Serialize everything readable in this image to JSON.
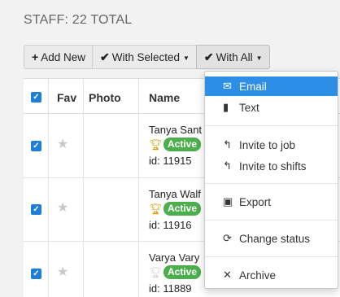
{
  "header": {
    "title": "STAFF: 22 TOTAL"
  },
  "toolbar": {
    "add_new": "Add New",
    "with_selected": "With Selected",
    "with_all": "With All"
  },
  "table": {
    "headers": {
      "fav": "Fav",
      "photo": "Photo",
      "name": "Name"
    },
    "rows": [
      {
        "name": "Tanya Sant",
        "status": "Active",
        "id": "id: 11915",
        "trophy": "gold"
      },
      {
        "name": "Tanya Walf",
        "status": "Active",
        "id": "id: 11916",
        "trophy": "gold"
      },
      {
        "name": "Varya Vary",
        "status": "Active",
        "id": "id: 11889",
        "trophy": "grey"
      }
    ]
  },
  "menu": {
    "email": "Email",
    "text": "Text",
    "invite_job": "Invite to job",
    "invite_shifts": "Invite to shifts",
    "export": "Export",
    "change_status": "Change status",
    "archive": "Archive"
  },
  "colors": {
    "accent": "#2d8ee6",
    "active_badge": "#4cae4c",
    "checkbox": "#1f7fd8",
    "trophy_gold": "#d4a017"
  }
}
